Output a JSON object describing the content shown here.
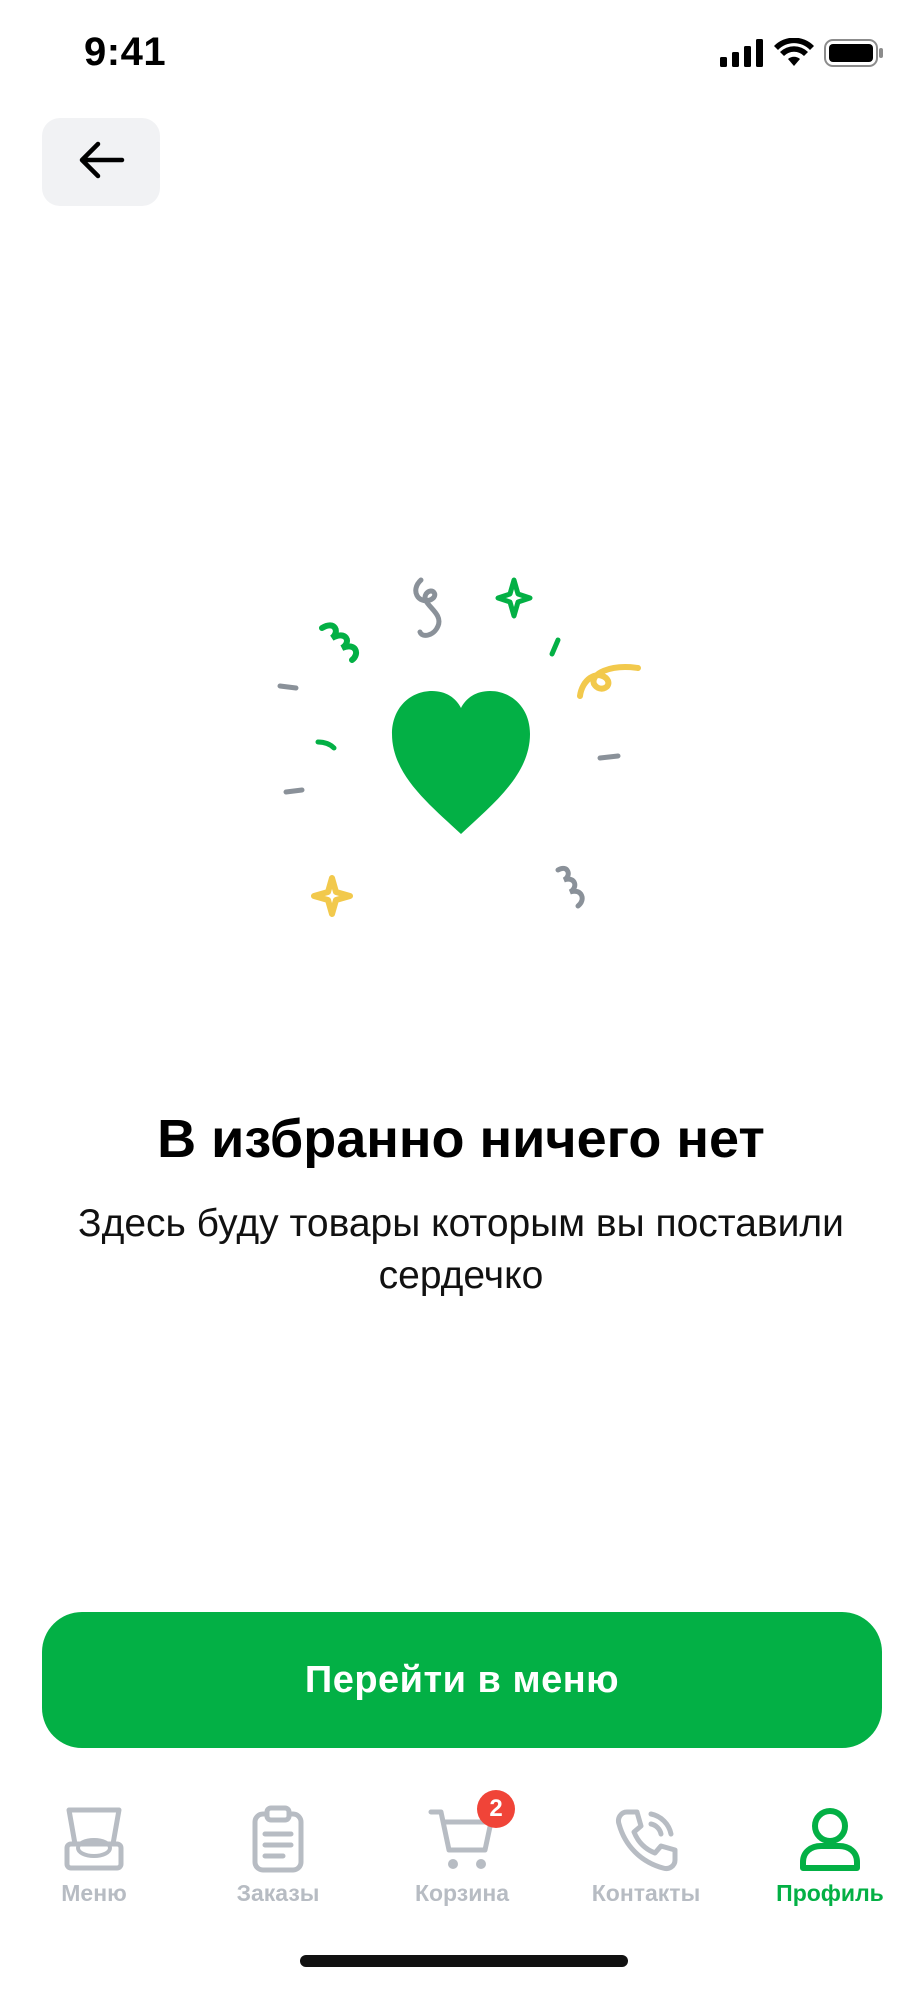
{
  "status_bar": {
    "time": "9:41",
    "icons": [
      "signal-icon",
      "wifi-icon",
      "battery-icon"
    ]
  },
  "header": {
    "back_icon": "arrow-left-icon"
  },
  "illustration": {
    "icon": "heart-icon",
    "colors": {
      "heart": "#03B045",
      "yellow": "#F2C94C",
      "gray": "#8A9199"
    }
  },
  "empty_state": {
    "title": "В избранно ничего нет",
    "subtitle": "Здесь буду товары которым вы поставили сердечко"
  },
  "primary_button": {
    "label": "Перейти в меню"
  },
  "tab_bar": {
    "tabs": [
      {
        "label": "Меню",
        "icon": "pizza-box-icon",
        "active": false
      },
      {
        "label": "Заказы",
        "icon": "clipboard-icon",
        "active": false
      },
      {
        "label": "Корзина",
        "icon": "cart-icon",
        "active": false,
        "badge": "2"
      },
      {
        "label": "Контакты",
        "icon": "phone-icon",
        "active": false
      },
      {
        "label": "Профиль",
        "icon": "profile-icon",
        "active": true
      }
    ]
  },
  "colors": {
    "accent": "#03B045",
    "inactive": "#B7BCC3",
    "badge": "#F04438"
  }
}
